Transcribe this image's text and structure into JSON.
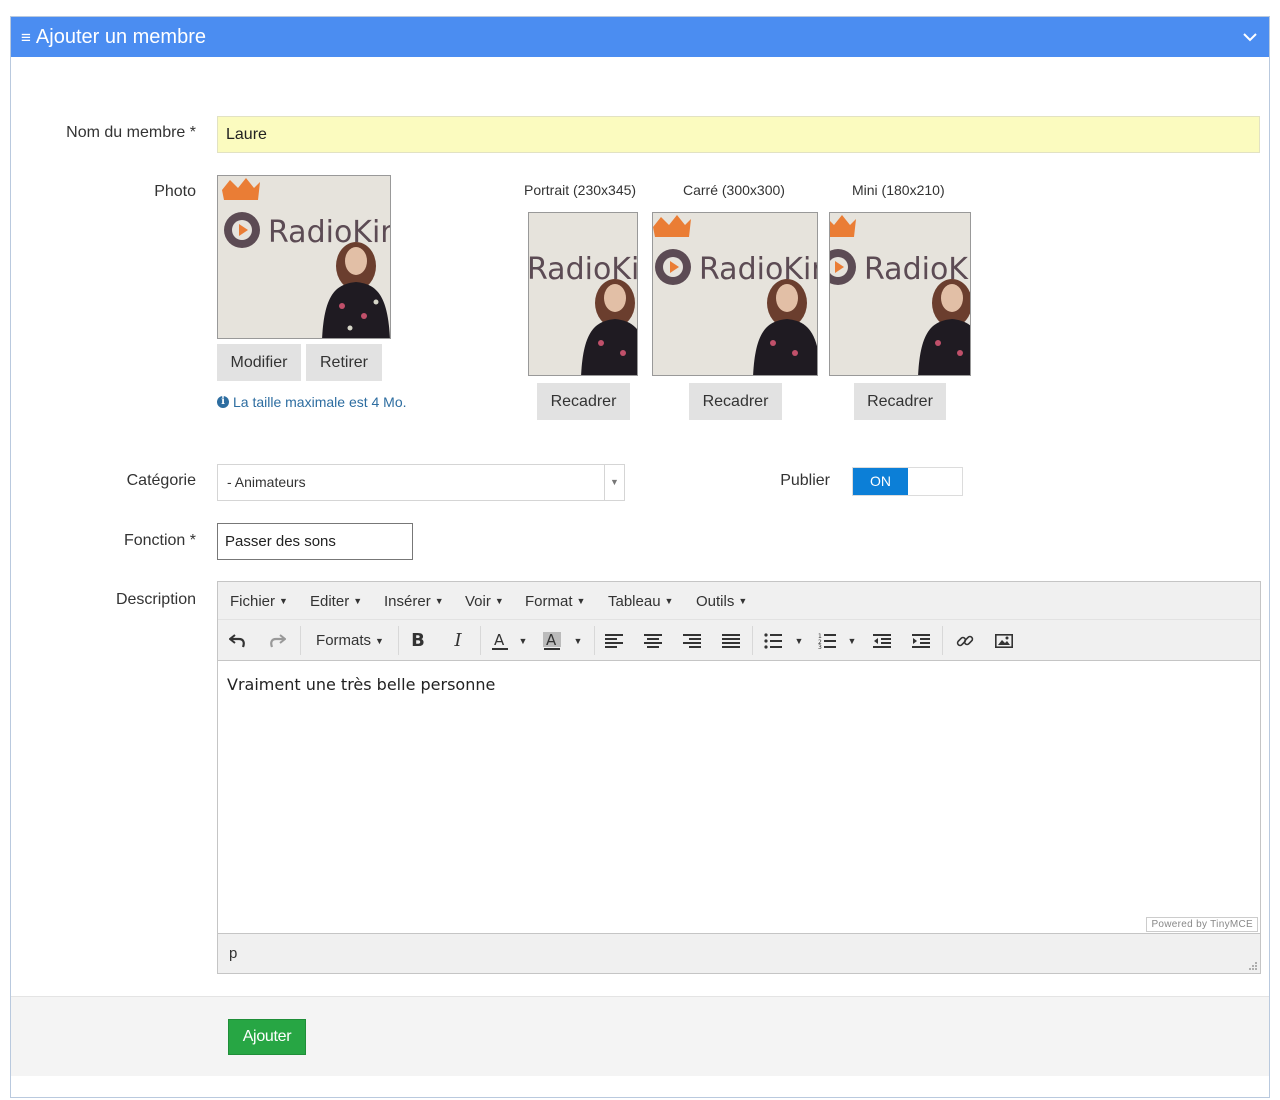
{
  "header": {
    "title": "Ajouter un membre",
    "menu_icon": "hamburger-icon",
    "collapse_icon": "chevron-down-icon",
    "color": "#4b8df1"
  },
  "form": {
    "name": {
      "label": "Nom du membre *",
      "value": "Laure"
    },
    "photo": {
      "label": "Photo",
      "logo_text": "RadioKing",
      "modify_label": "Modifier",
      "remove_label": "Retirer",
      "max_size_note": "La taille maximale est 4 Mo."
    },
    "crops": [
      {
        "title": "Portrait (230x345)",
        "button": "Recadrer"
      },
      {
        "title": "Carré (300x300)",
        "button": "Recadrer"
      },
      {
        "title": "Mini (180x210)",
        "button": "Recadrer"
      }
    ],
    "category": {
      "label": "Catégorie",
      "selected": "- Animateurs"
    },
    "publish": {
      "label": "Publier",
      "state": "ON",
      "on_color": "#0c7fd7"
    },
    "function": {
      "label": "Fonction *",
      "value": "Passer des sons"
    },
    "description": {
      "label": "Description",
      "menu": [
        "Fichier",
        "Editer",
        "Insérer",
        "Voir",
        "Format",
        "Tableau",
        "Outils"
      ],
      "formats_label": "Formats",
      "content": "Vraiment une très belle personne",
      "powered_by": "Powered by TinyMCE",
      "path": "p"
    }
  },
  "footer": {
    "submit_label": "Ajouter",
    "submit_color": "#27a644"
  }
}
